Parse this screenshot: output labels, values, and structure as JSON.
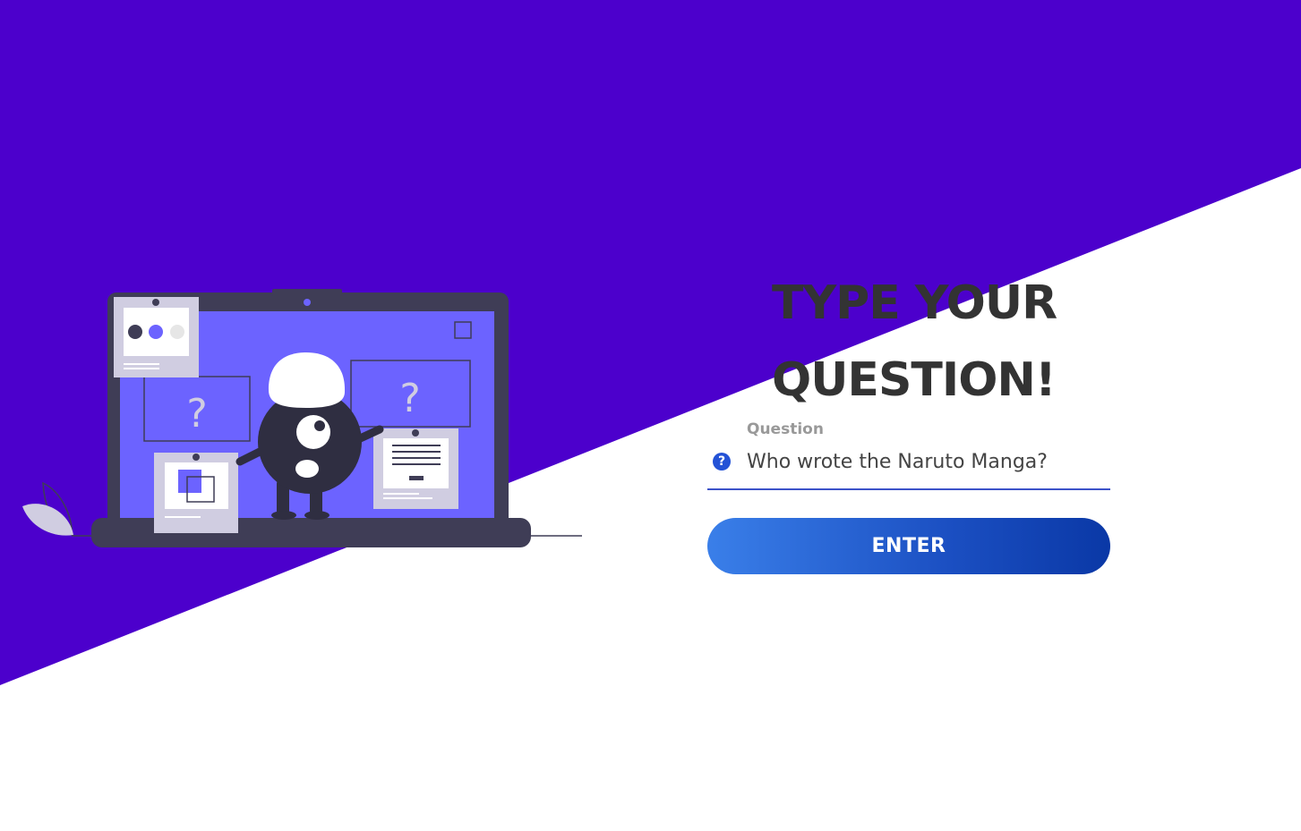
{
  "colors": {
    "background_purple": "#4c00cc",
    "background_white": "#ffffff",
    "headline": "#333333",
    "accent_blue": "#2352d6",
    "button_gradient_start": "#3a7fe9",
    "button_gradient_end": "#0a38a6",
    "illustration_screen": "#6c63ff",
    "illustration_dark": "#3f3d56"
  },
  "hero": {
    "headline": "TYPE YOUR QUESTION!"
  },
  "form": {
    "question_label": "Question",
    "question_value": "Who wrote the Naruto Manga?",
    "question_icon": "question-circle-icon",
    "enter_label": "ENTER"
  },
  "illustration": {
    "panel_mark_left": "?",
    "panel_mark_right": "?"
  }
}
